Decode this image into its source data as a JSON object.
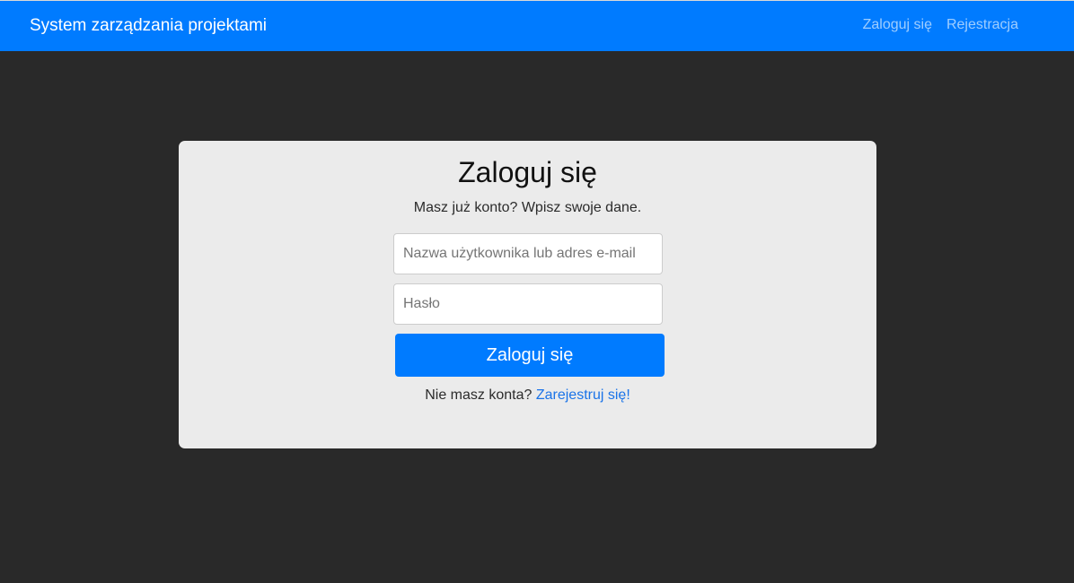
{
  "header": {
    "brand": "System zarządzania projektami",
    "nav": {
      "login": "Zaloguj się",
      "register": "Rejestracja"
    }
  },
  "login_form": {
    "title": "Zaloguj się",
    "subtitle": "Masz już konto? Wpisz swoje dane.",
    "username_placeholder": "Nazwa użytkownika lub adres e-mail",
    "username_value": "",
    "password_placeholder": "Hasło",
    "password_value": "",
    "submit_label": "Zaloguj się",
    "register_prompt": "Nie masz konta?",
    "register_link": "Zarejestruj się!"
  },
  "colors": {
    "primary": "#007bff",
    "background": "#292929",
    "card": "#ebebeb"
  }
}
